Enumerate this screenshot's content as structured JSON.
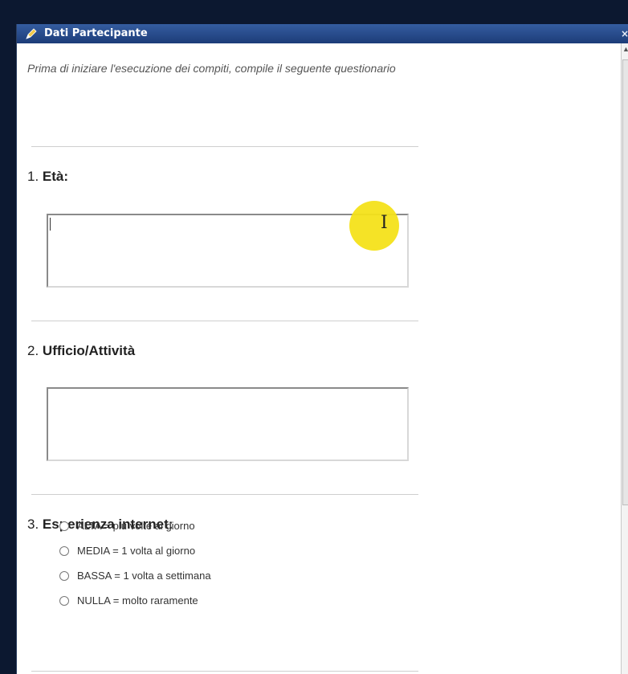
{
  "window": {
    "title": "Dati Partecipante",
    "close_glyph": "×"
  },
  "intro": "Prima di iniziare l'esecuzione dei compiti, compile il seguente questionario",
  "questions": [
    {
      "number": "1.",
      "label": "Età:"
    },
    {
      "number": "2.",
      "label": "Ufficio/Attività"
    },
    {
      "number": "3.",
      "label": "Esperienza internet:"
    }
  ],
  "fields": {
    "age_value": "",
    "office_value": ""
  },
  "internet_options": [
    "ALTA = più volte al giorno",
    "MEDIA = 1 volta al giorno",
    "BASSA = 1 volta a settimana",
    "NULLA = molto raramente"
  ],
  "icons": {
    "title": "pencil-icon",
    "cursor": "text-cursor-icon"
  },
  "colors": {
    "titlebar": "#1d3c78",
    "cursor_highlight": "#f4e21a"
  }
}
